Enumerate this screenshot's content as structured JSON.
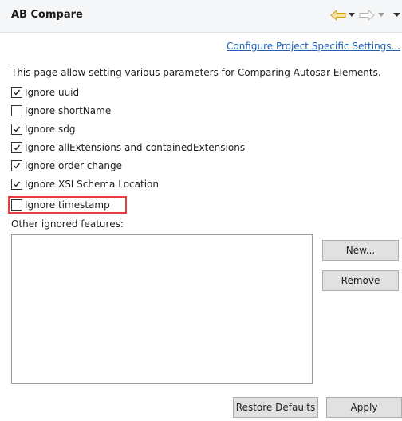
{
  "header": {
    "title": "AB Compare",
    "nav_icons": [
      "back-arrow-icon",
      "back-menu-icon",
      "forward-arrow-icon",
      "forward-menu-icon",
      "view-menu-icon"
    ],
    "accent_color": "#e8b32a"
  },
  "link": {
    "label": "Configure Project Specific Settings..."
  },
  "description": "This page allow setting various parameters for Comparing Autosar Elements.",
  "options": [
    {
      "label": "Ignore uuid",
      "checked": true
    },
    {
      "label": "Ignore shortName",
      "checked": false
    },
    {
      "label": "Ignore sdg",
      "checked": true
    },
    {
      "label": "Ignore allExtensions and containedExtensions",
      "checked": true
    },
    {
      "label": "Ignore order change",
      "checked": true
    },
    {
      "label": "Ignore XSI Schema Location",
      "checked": true
    },
    {
      "label": "Ignore timestamp",
      "checked": false
    }
  ],
  "other_features": {
    "label": "Other ignored features:",
    "items": []
  },
  "buttons": {
    "new": "New...",
    "remove": "Remove",
    "restore_defaults": "Restore Defaults",
    "apply": "Apply"
  },
  "highlight_color": "#e53d3d"
}
